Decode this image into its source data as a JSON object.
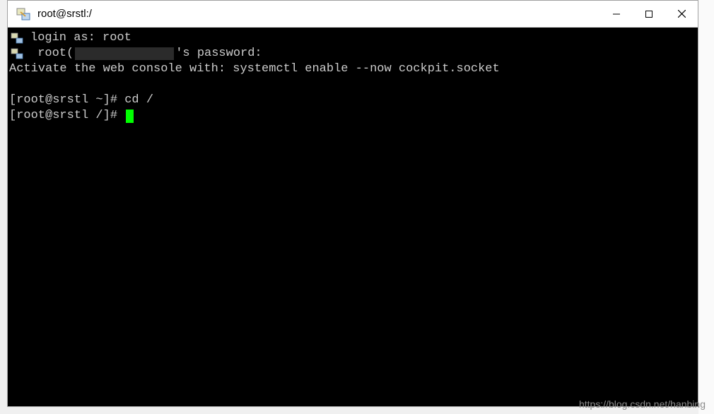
{
  "window": {
    "title": "root@srstl:/"
  },
  "terminal": {
    "lines": {
      "login_prompt": "login as: root",
      "password_prefix": " root(",
      "password_suffix": "'s password:",
      "activate_msg": "Activate the web console with: systemctl enable --now cockpit.socket",
      "prompt1": "[root@srstl ~]# cd /",
      "prompt2": "[root@srstl /]# "
    }
  },
  "watermark": "https://blog.csdn.net/hanbing"
}
